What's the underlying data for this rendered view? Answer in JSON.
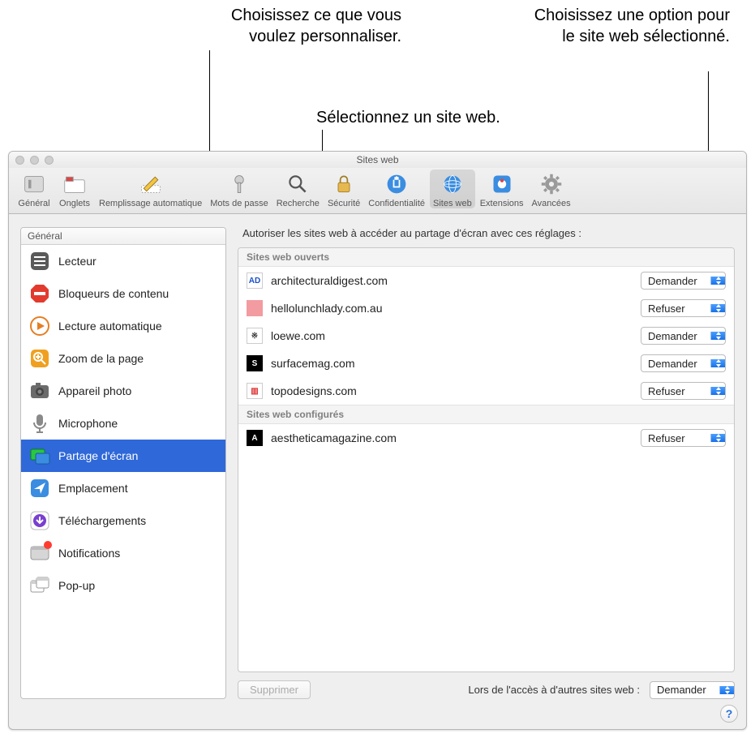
{
  "callouts": {
    "c1": "Choisissez ce que vous voulez personnaliser.",
    "c2": "Choisissez une option pour le site web sélectionné.",
    "c3": "Sélectionnez un site web."
  },
  "window": {
    "title": "Sites web"
  },
  "toolbar": [
    {
      "id": "general",
      "label": "Général"
    },
    {
      "id": "tabs",
      "label": "Onglets"
    },
    {
      "id": "autofill",
      "label": "Remplissage automatique"
    },
    {
      "id": "passwords",
      "label": "Mots de passe"
    },
    {
      "id": "search",
      "label": "Recherche"
    },
    {
      "id": "security",
      "label": "Sécurité"
    },
    {
      "id": "privacy",
      "label": "Confidentialité"
    },
    {
      "id": "websites",
      "label": "Sites web"
    },
    {
      "id": "extensions",
      "label": "Extensions"
    },
    {
      "id": "advanced",
      "label": "Avancées"
    }
  ],
  "sidebar": {
    "header": "Général",
    "items": [
      {
        "id": "reader",
        "label": "Lecteur"
      },
      {
        "id": "contentblockers",
        "label": "Bloqueurs de contenu"
      },
      {
        "id": "autoplay",
        "label": "Lecture automatique"
      },
      {
        "id": "zoom",
        "label": "Zoom de la page"
      },
      {
        "id": "camera",
        "label": "Appareil photo"
      },
      {
        "id": "microphone",
        "label": "Microphone"
      },
      {
        "id": "screenshare",
        "label": "Partage d'écran",
        "selected": true
      },
      {
        "id": "location",
        "label": "Emplacement"
      },
      {
        "id": "downloads",
        "label": "Téléchargements"
      },
      {
        "id": "notifications",
        "label": "Notifications",
        "badge": true
      },
      {
        "id": "popup",
        "label": "Pop-up"
      }
    ]
  },
  "main": {
    "intro": "Autoriser les sites web à accéder au partage d'écran avec ces réglages :",
    "sections": {
      "open": {
        "title": "Sites web ouverts",
        "rows": [
          {
            "domain": "architecturaldigest.com",
            "option": "Demander",
            "fav": {
              "text": "AD",
              "bg": "#ffffff",
              "fg": "#1a4fc9"
            }
          },
          {
            "domain": "hellolunchlady.com.au",
            "option": "Refuser",
            "fav": {
              "text": "",
              "bg": "#f29ba0",
              "fg": "#fff"
            }
          },
          {
            "domain": "loewe.com",
            "option": "Demander",
            "fav": {
              "text": "※",
              "bg": "#ffffff",
              "fg": "#333"
            }
          },
          {
            "domain": "surfacemag.com",
            "option": "Demander",
            "fav": {
              "text": "S",
              "bg": "#000000",
              "fg": "#fff"
            }
          },
          {
            "domain": "topodesigns.com",
            "option": "Refuser",
            "fav": {
              "text": "▥",
              "bg": "#ffffff",
              "fg": "#d33"
            }
          }
        ]
      },
      "configured": {
        "title": "Sites web configurés",
        "rows": [
          {
            "domain": "aestheticamagazine.com",
            "option": "Refuser",
            "fav": {
              "text": "A",
              "bg": "#000000",
              "fg": "#fff"
            }
          }
        ]
      }
    },
    "footer": {
      "remove": "Supprimer",
      "other_label": "Lors de l'accès à d'autres sites web :",
      "other_value": "Demander"
    }
  },
  "help": "?"
}
